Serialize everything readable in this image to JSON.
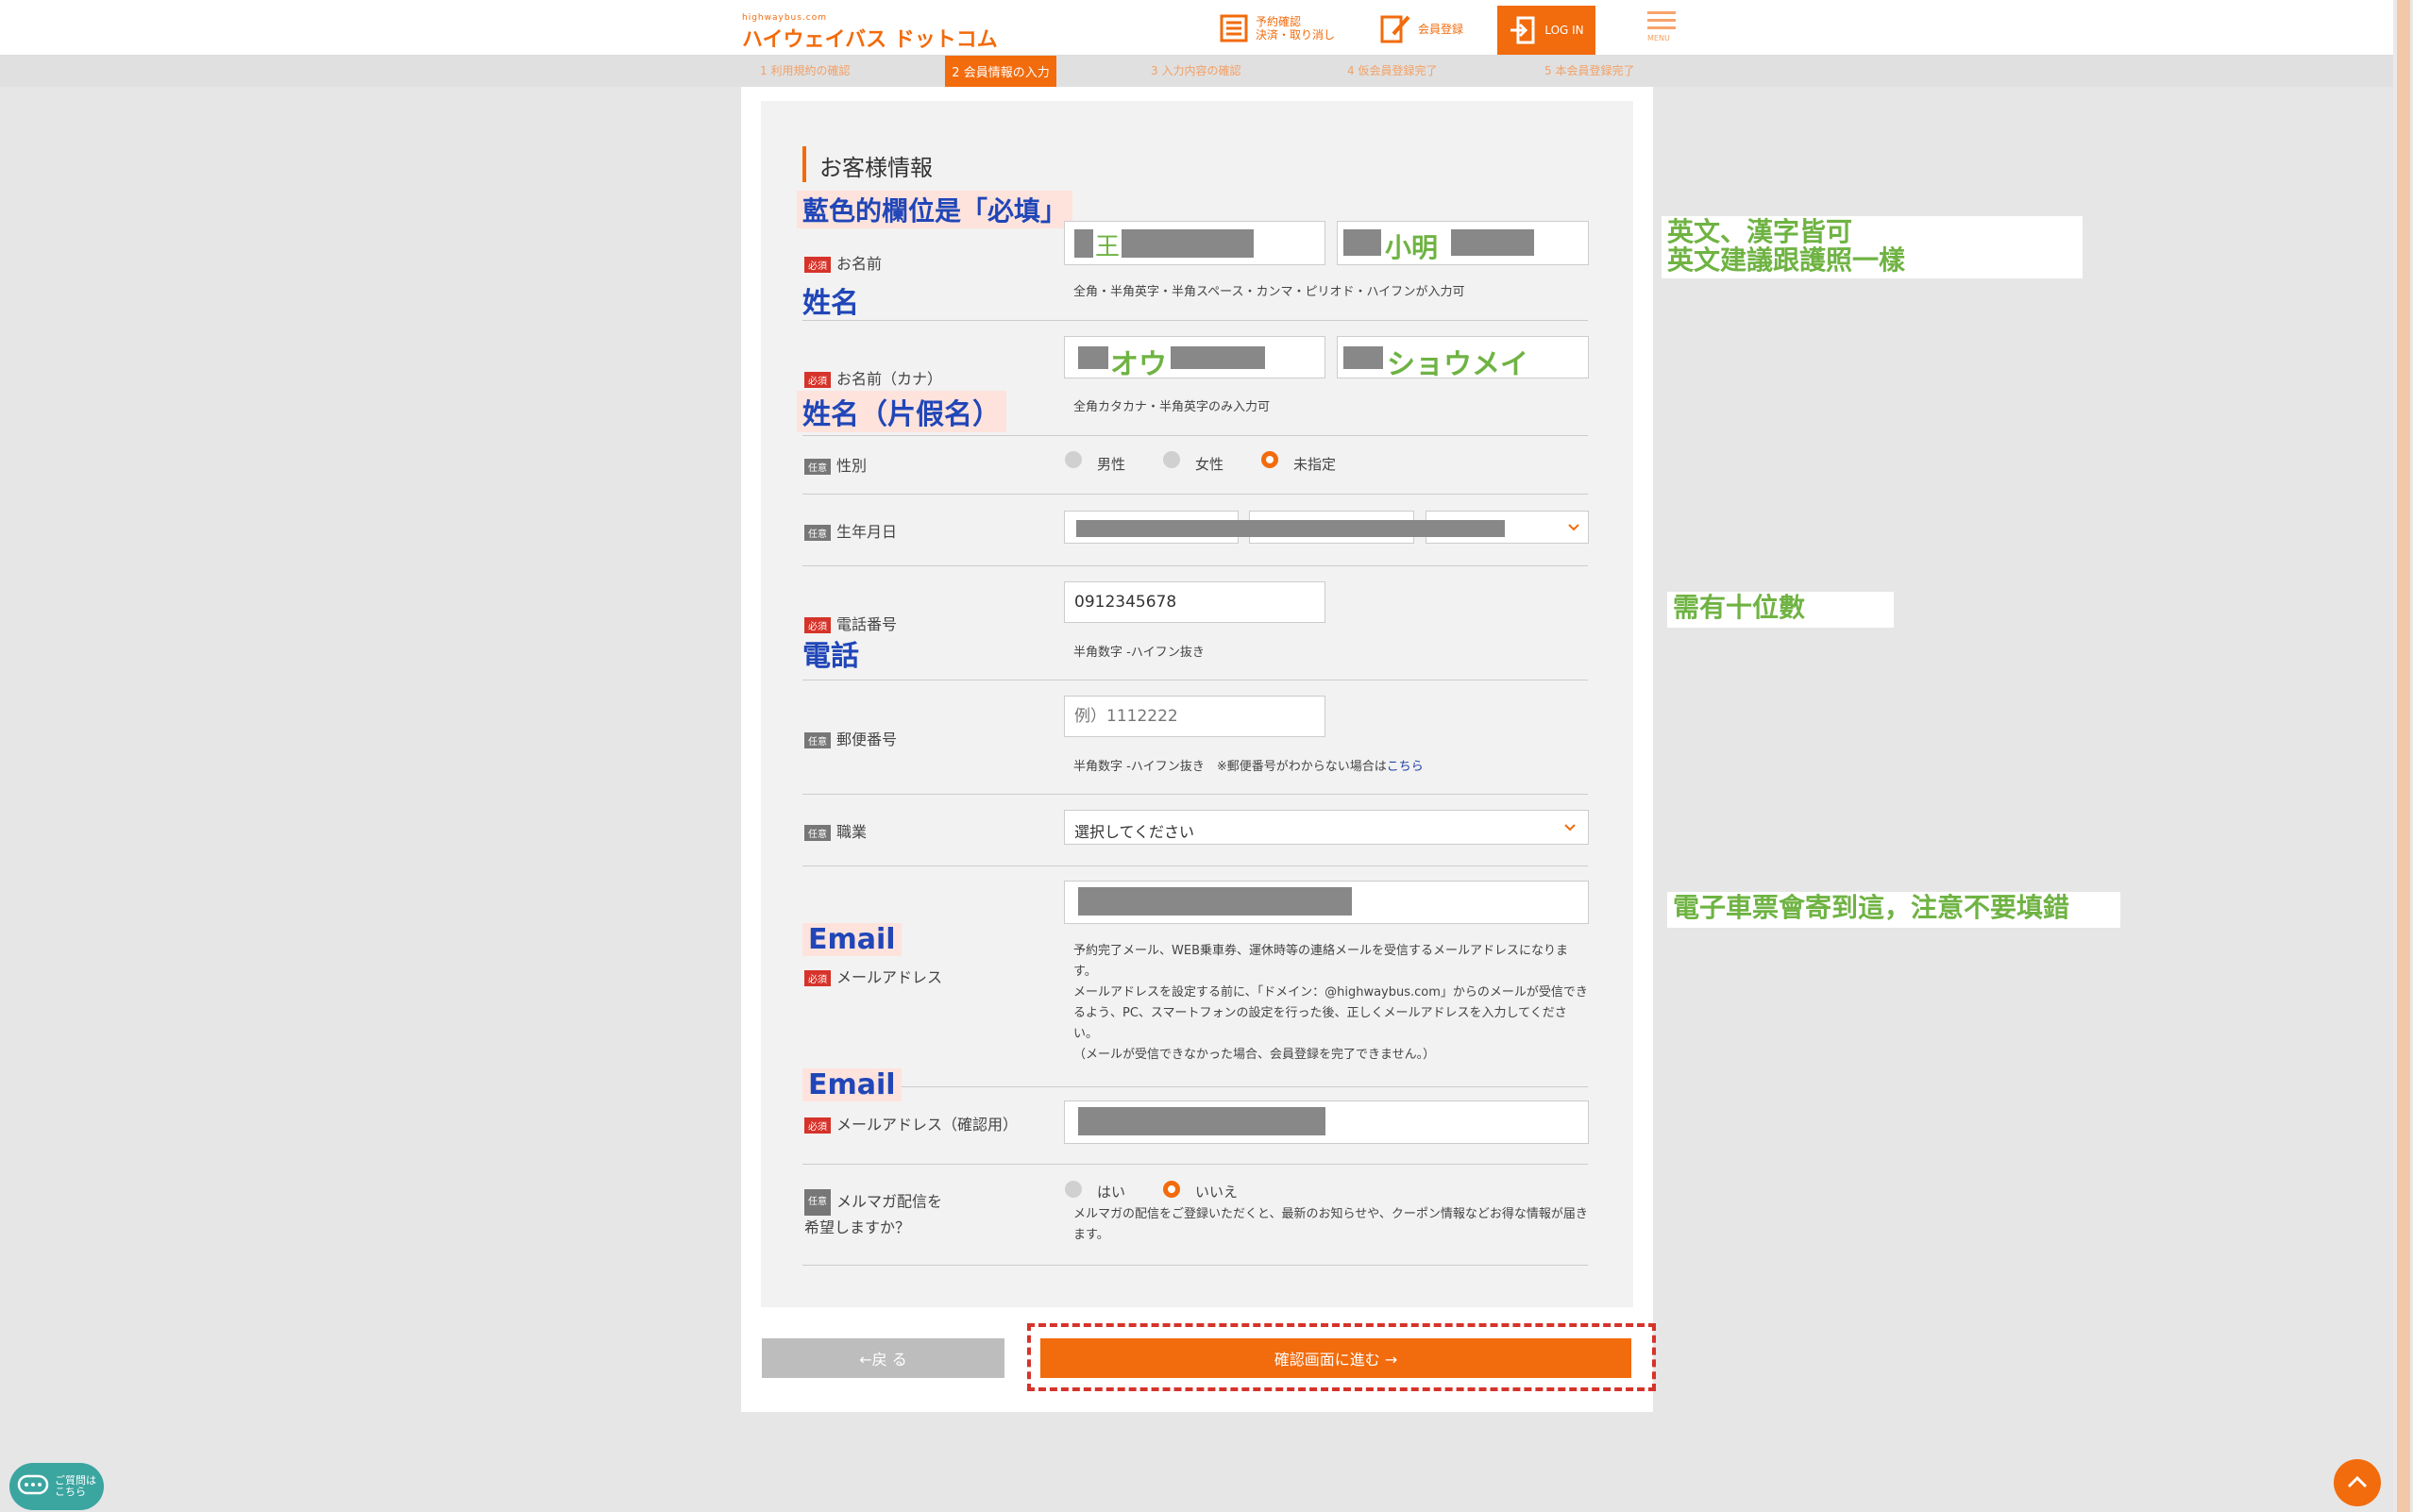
{
  "header": {
    "logo_small": "highwaybus.com",
    "logo_main": "ハイウェイバス ドットコム",
    "reserve_line1": "予約確認",
    "reserve_line2": "決済・取り消し",
    "register_label": "会員登録",
    "login_label": "LOG IN",
    "menu_label": "MENU"
  },
  "steps": [
    {
      "label": "1 利用規約の確認"
    },
    {
      "label": "2 会員情報の入力"
    },
    {
      "label": "3 入力内容の確認"
    },
    {
      "label": "4 仮会員登録完了"
    },
    {
      "label": "5 本会員登録完了"
    }
  ],
  "form": {
    "section_title": "お客様情報",
    "required_tag": "必須",
    "optional_tag": "任意",
    "name": {
      "label": "お名前",
      "last_value": "王",
      "first_value": "小明",
      "hint": "全角・半角英字・半角スペース・カンマ・ピリオド・ハイフンが入力可"
    },
    "kana": {
      "label": "お名前（カナ）",
      "last_value": "オウ",
      "first_value": "ショウメイ",
      "hint": "全角カタカナ・半角英字のみ入力可"
    },
    "gender": {
      "label": "性別",
      "options": [
        "男性",
        "女性",
        "未指定"
      ],
      "selected": "未指定"
    },
    "birthday": {
      "label": "生年月日"
    },
    "phone": {
      "label": "電話番号",
      "value": "0912345678",
      "hint": "半角数字 -ハイフン抜き"
    },
    "postal": {
      "label": "郵便番号",
      "placeholder": "例）1112222",
      "hint_prefix": "半角数字 -ハイフン抜き　※郵便番号がわからない場合は",
      "hint_link": "こちら"
    },
    "occupation": {
      "label": "職業",
      "value": "選択してください"
    },
    "email": {
      "label": "メールアドレス",
      "hint1": "予約完了メール、WEB乗車券、運休時等の連絡メールを受信するメールアドレスになります。",
      "hint2": "メールアドレスを設定する前に、「ドメイン：@highwaybus.com」からのメールが受信できるよう、PC、スマートフォンの設定を行った後、正しくメールアドレスを入力してください。",
      "hint3": "（メールが受信できなかった場合、会員登録を完了できません。）"
    },
    "email_confirm": {
      "label": "メールアドレス（確認用）"
    },
    "newsletter": {
      "label_line1": "メルマガ配信を",
      "label_line2": "希望しますか？",
      "options": [
        "はい",
        "いいえ"
      ],
      "selected": "いいえ",
      "hint": "メルマガの配信をご登録いただくと、最新のお知らせや、クーポン情報などお得な情報が届きます。"
    }
  },
  "buttons": {
    "back": "←戻 る",
    "confirm": "確認画面に進む →"
  },
  "annotations": {
    "required_note": "藍色的欄位是「必填」",
    "name": "姓名",
    "kana": "姓名（片假名）",
    "phone": "電話",
    "email1": "Email",
    "email2": "Email",
    "note_name_line1": "英文、漢字皆可",
    "note_name_line2": "英文建議跟護照一樣",
    "note_phone": "需有十位數",
    "note_email": "電子車票會寄到這，注意不要填錯"
  },
  "chat": {
    "line1": "ご質問は",
    "line2": "こちら"
  },
  "colors": {
    "accent": "#f26b0c",
    "required": "#d6332a",
    "annotation_blue": "#2046b8",
    "annotation_green": "#6fb343"
  }
}
